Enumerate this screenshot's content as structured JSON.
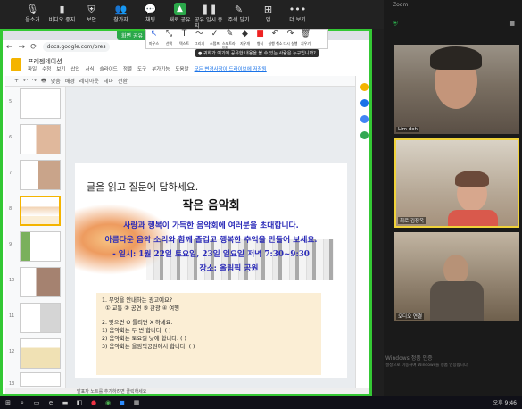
{
  "zoom_toolbar": {
    "items": [
      {
        "label": "음소거",
        "icon": "mic-icon"
      },
      {
        "label": "비디오 중지",
        "icon": "video-icon"
      },
      {
        "label": "보안",
        "icon": "shield-icon"
      },
      {
        "label": "참가자",
        "icon": "participants-icon"
      },
      {
        "label": "채팅",
        "icon": "chat-icon"
      },
      {
        "label": "새로 공유",
        "icon": "new-share-icon"
      },
      {
        "label": "공유 일시 중지",
        "icon": "pause-icon"
      },
      {
        "label": "주석 달기",
        "icon": "annotate-icon"
      },
      {
        "label": "앱",
        "icon": "apps-icon"
      },
      {
        "label": "더 보기",
        "icon": "more-icon"
      }
    ]
  },
  "share_banner": "화면 공유 중",
  "browser": {
    "url": "docs.google.com/pres"
  },
  "annotate_toolbar": {
    "items": [
      {
        "label": "마우스",
        "icon": "cursor-icon"
      },
      {
        "label": "선택",
        "icon": "select-icon"
      },
      {
        "label": "텍스트",
        "icon": "text-icon"
      },
      {
        "label": "그리기",
        "icon": "draw-icon"
      },
      {
        "label": "스탬프",
        "icon": "stamp-icon"
      },
      {
        "label": "스포트라이트",
        "icon": "spotlight-icon"
      },
      {
        "label": "지우개",
        "icon": "eraser-icon"
      },
      {
        "label": "형식",
        "icon": "format-icon"
      },
      {
        "label": "실행 취소",
        "icon": "undo-icon"
      },
      {
        "label": "다시 실행",
        "icon": "redo-icon"
      },
      {
        "label": "지우기",
        "icon": "clear-icon"
      }
    ]
  },
  "question_tip": "귀하가 여기에 공유한 내용을 볼 수 있는 사람은 누구입니까?",
  "slides": {
    "title": "프레젠테이션",
    "menus": [
      "파일",
      "수정",
      "보기",
      "삽입",
      "서식",
      "슬라이드",
      "정렬",
      "도구",
      "부가기능",
      "도움말",
      "모든 변경사항이 드라이브에 저장됨"
    ],
    "toolbar": [
      "+",
      "↶",
      "↷",
      "🖶",
      "맞춤",
      "배경",
      "레이아웃",
      "테마",
      "전환"
    ],
    "thumb_numbers": [
      "5",
      "6",
      "7",
      "8",
      "9",
      "10",
      "11",
      "12",
      "13"
    ]
  },
  "slide": {
    "instruction": "글을 읽고 질문에 답하세요.",
    "title": "작은 음악회",
    "line1": "사랑과 행복이 가득한 음악회에 여러분을 초대합니다.",
    "line2": "아름다운 음악 소리와 함께 즐겁고 행복한 추억을 만들어 보세요.",
    "line3": "- 일시: 1월 22일 토요일, 23일 일요일 저녁 7:30~9:30",
    "line4": "장소:  올림픽 공원",
    "q1": "1. 무엇을 안내하는 광고예요?",
    "q1_options": "① 교통    ② 공연    ③ 관광    ④ 여행",
    "q2": "2. 맞으면 O 틀리면 X 하세요.",
    "q2_a": "1) 음악회는 두 번 합니다. (     )",
    "q2_b": "2) 음악회는 토요일 낮에 합니다.  (     )",
    "q2_c": "3) 음악회는 올림픽공원에서 합니다. (     )"
  },
  "speaker_notes": "발표자 노트를 추가하려면 클릭하세요",
  "zoom_panel": {
    "title": "Zoom",
    "participants": [
      {
        "name": "Lim doh"
      },
      {
        "name": "최로 김정옥"
      },
      {
        "name": "오디오 연결"
      }
    ],
    "watermark1": "Windows 정품 인증",
    "watermark2": "설정으로 이동하여 Windows를 정품 인증합니다."
  },
  "taskbar": {
    "clock": "오후 9:46"
  }
}
